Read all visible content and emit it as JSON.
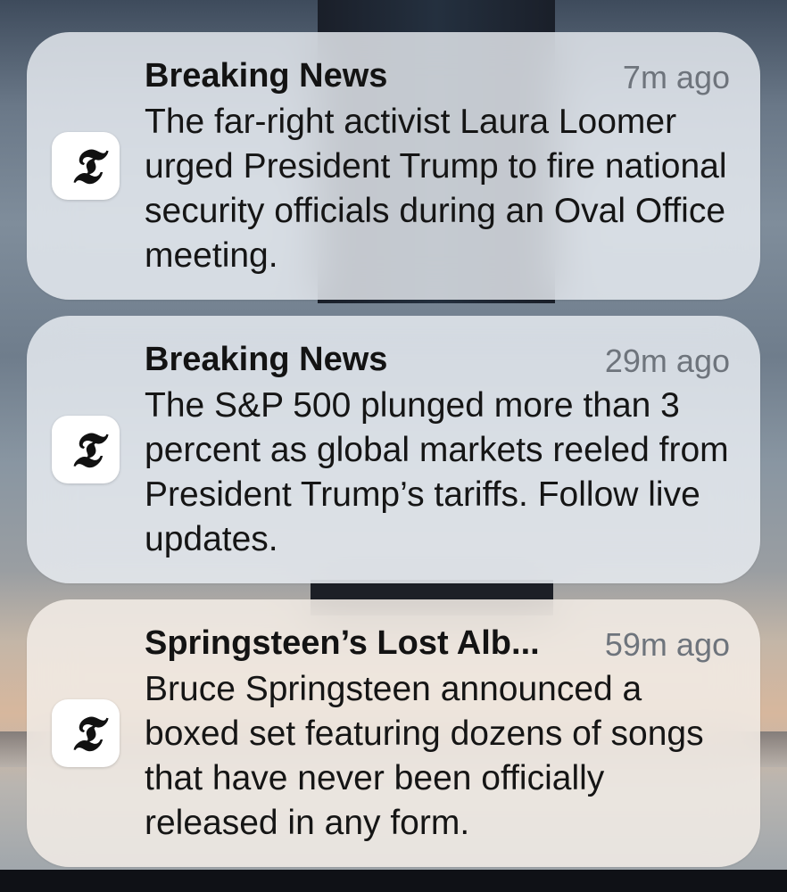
{
  "notifications": [
    {
      "app_icon": "nyt-logo-icon",
      "app_glyph": "𝕿",
      "title": "Breaking News",
      "time": "7m ago",
      "body": "The far-right activist Laura Loomer urged President Trump to fire national security officials during an Oval Office meeting."
    },
    {
      "app_icon": "nyt-logo-icon",
      "app_glyph": "𝕿",
      "title": "Breaking News",
      "time": "29m ago",
      "body": "The S&P 500 plunged more than 3 percent as global markets reeled from President Trump’s tariffs. Follow live updates."
    },
    {
      "app_icon": "nyt-logo-icon",
      "app_glyph": "𝕿",
      "title": "Springsteen’s Lost Alb...",
      "time": "59m ago",
      "body": "Bruce Springsteen announced a boxed set featuring dozens of songs that have never been officially released in any form."
    }
  ]
}
